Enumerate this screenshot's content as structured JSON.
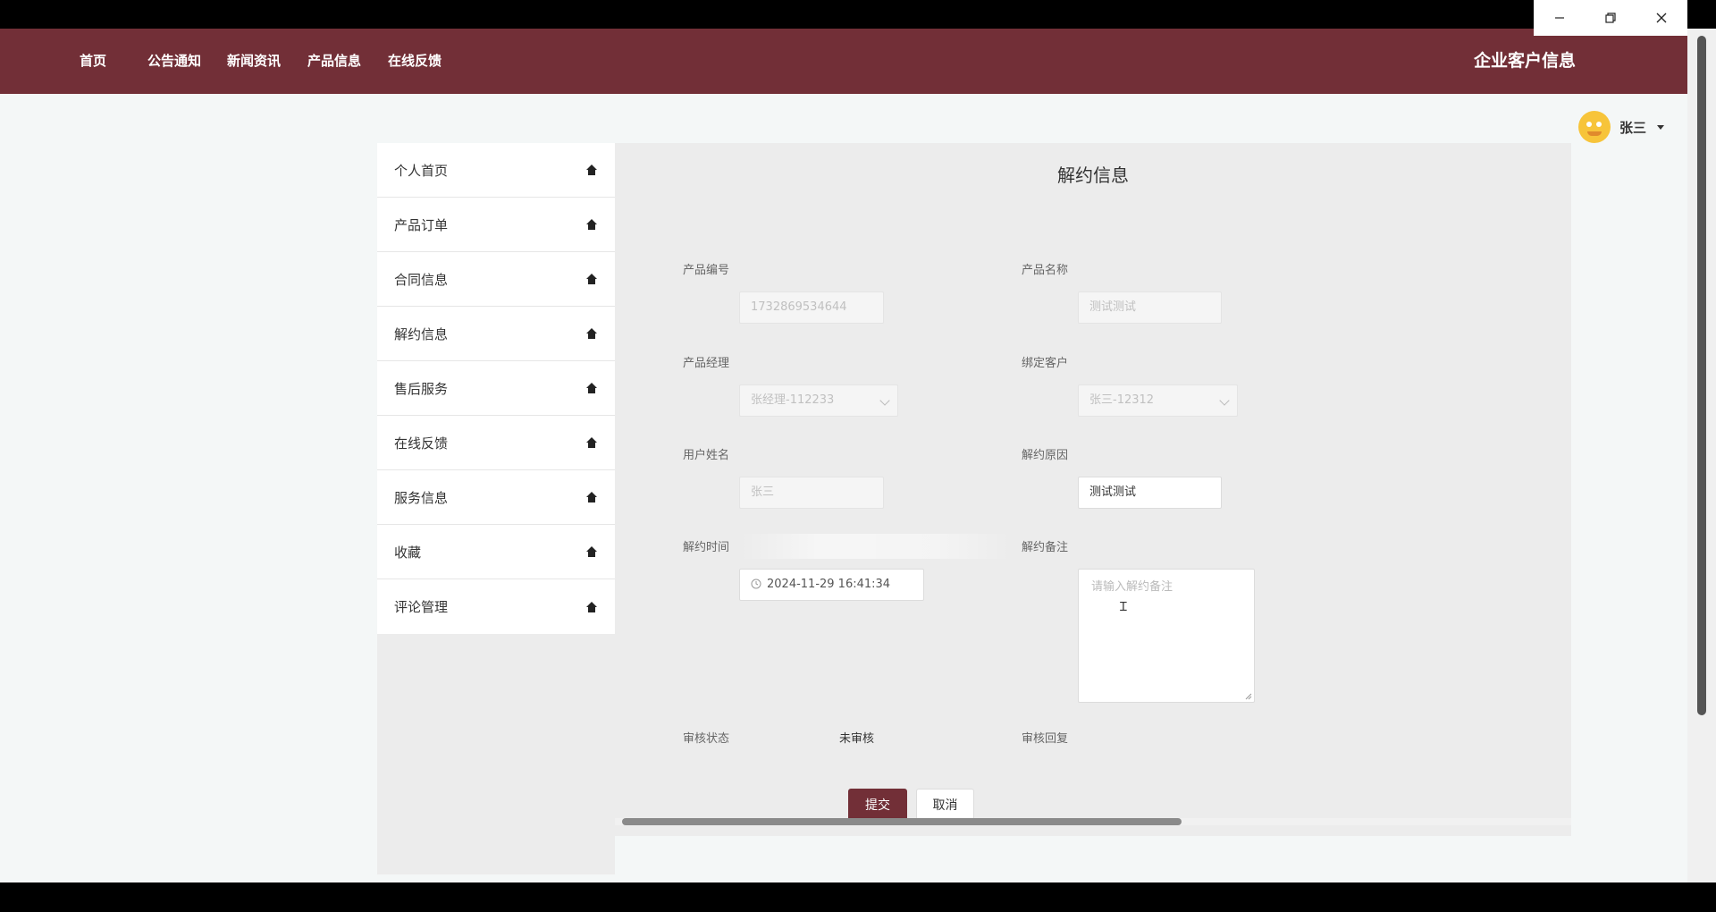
{
  "nav": {
    "items": [
      "首页",
      "公告通知",
      "新闻资讯",
      "产品信息",
      "在线反馈"
    ],
    "site_title": "企业客户信息"
  },
  "user": {
    "name": "张三"
  },
  "sidebar": {
    "items": [
      {
        "label": "个人首页",
        "icon": "home-icon"
      },
      {
        "label": "产品订单",
        "icon": "home-icon"
      },
      {
        "label": "合同信息",
        "icon": "home-icon"
      },
      {
        "label": "解约信息",
        "icon": "home-icon"
      },
      {
        "label": "售后服务",
        "icon": "home-icon"
      },
      {
        "label": "在线反馈",
        "icon": "home-icon"
      },
      {
        "label": "服务信息",
        "icon": "home-icon"
      },
      {
        "label": "收藏",
        "icon": "home-icon"
      },
      {
        "label": "评论管理",
        "icon": "home-icon"
      }
    ]
  },
  "form": {
    "title": "解约信息",
    "product_no": {
      "label": "产品编号",
      "value": "1732869534644"
    },
    "product_name": {
      "label": "产品名称",
      "value": "测试测试"
    },
    "product_manager": {
      "label": "产品经理",
      "value": "张经理-112233"
    },
    "bound_customer": {
      "label": "绑定客户",
      "value": "张三-12312"
    },
    "user_name": {
      "label": "用户姓名",
      "value": "张三"
    },
    "termination_reason": {
      "label": "解约原因",
      "value": "测试测试"
    },
    "termination_time": {
      "label": "解约时间",
      "value": "2024-11-29 16:41:34"
    },
    "termination_note": {
      "label": "解约备注",
      "placeholder": "请输入解约备注"
    },
    "review_status": {
      "label": "审核状态",
      "value": "未审核"
    },
    "review_reply": {
      "label": "审核回复"
    },
    "submit_label": "提交",
    "cancel_label": "取消"
  },
  "colors": {
    "brand": "#722f37",
    "page_bg": "#f4f7f7",
    "panel_bg": "#ececec"
  }
}
